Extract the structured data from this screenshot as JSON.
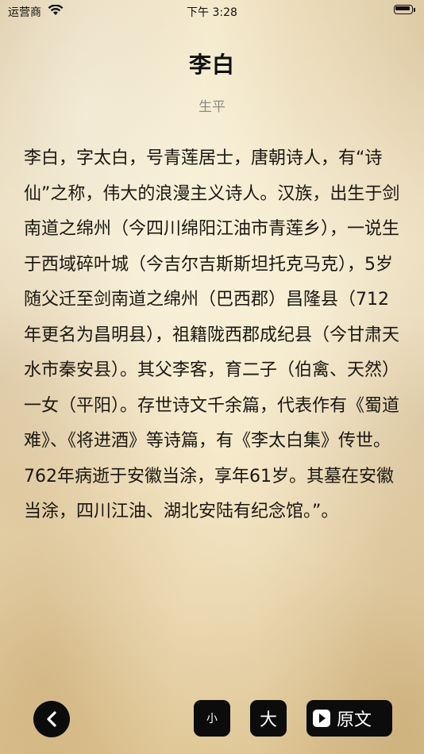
{
  "status_bar": {
    "carrier": "运营商",
    "time": "下午 3:28",
    "wifi_icon": "wifi-icon",
    "battery_icon": "battery-icon"
  },
  "article": {
    "title": "李白",
    "subtitle": "生平",
    "body": "李白，字太白，号青莲居士，唐朝诗人，有“诗仙”之称，伟大的浪漫主义诗人。汉族，出生于剑南道之绵州（今四川绵阳江油市青莲乡），一说生于西域碎叶城（今吉尔吉斯斯坦托克马克），5岁随父迁至剑南道之绵州（巴西郡）昌隆县（712年更名为昌明县），祖籍陇西郡成纪县（今甘肃天水市秦安县）。其父李客，育二子（伯禽、天然）一女（平阳）。存世诗文千余篇，代表作有《蜀道难》、《将进酒》等诗篇，有《李太白集》传世。762年病逝于安徽当涂，享年61岁。其墓在安徽当涂，四川江油、湖北安陆有纪念馆。”。"
  },
  "toolbar": {
    "back_icon": "chevron-left-icon",
    "small_label": "小",
    "large_label": "大",
    "original_label": "原文",
    "original_icon": "play-icon"
  }
}
